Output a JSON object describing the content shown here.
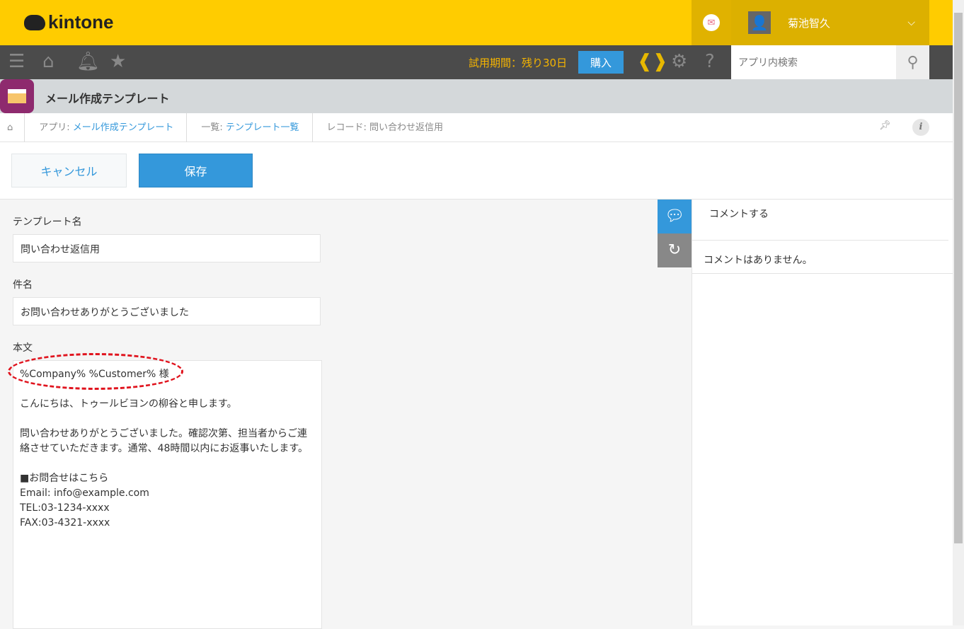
{
  "header": {
    "logo": "kintone",
    "user_name": "菊池智久"
  },
  "nav": {
    "trial": "試用期間：残り30日",
    "buy": "購入",
    "search_placeholder": "アプリ内検索"
  },
  "app": {
    "title": "メール作成テンプレート"
  },
  "breadcrumb": {
    "app_prefix": "アプリ: ",
    "app_name": "メール作成テンプレート",
    "list_prefix": "一覧: ",
    "list_name": "テンプレート一覧",
    "record": "レコード: 問い合わせ返信用"
  },
  "actions": {
    "cancel": "キャンセル",
    "save": "保存"
  },
  "form": {
    "name_label": "テンプレート名",
    "name_value": "問い合わせ返信用",
    "subject_label": "件名",
    "subject_value": "お問い合わせありがとうございました",
    "body_label": "本文",
    "body_value": "%Company% %Customer% 様\n\nこんにちは、トゥールビヨンの柳谷と申します。\n\n問い合わせありがとうございました。確認次第、担当者からご連\n絡させていただきます。通常、48時間以内にお返事いたします。\n\n■お問合せはこちら\nEmail: info@example.com\nTEL:03-1234-xxxx\nFAX:03-4321-xxxx"
  },
  "comments": {
    "placeholder": "コメントする",
    "empty": "コメントはありません。"
  }
}
